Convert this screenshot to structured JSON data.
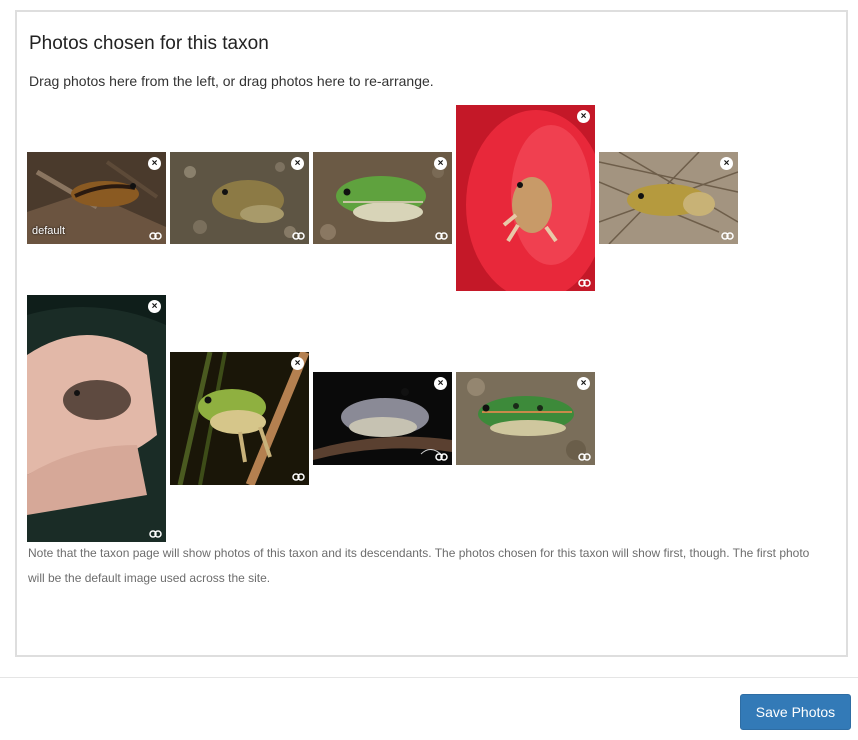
{
  "panel": {
    "title": "Photos chosen for this taxon",
    "instructions": "Drag photos here from the left, or drag photos here to re-arrange.",
    "note": "Note that the taxon page will show photos of this taxon and its descendants. The photos chosen for this taxon will show first, though. The first photo will be the default image used across the site."
  },
  "photos": {
    "default_label": "default",
    "remove_glyph": "×",
    "remove_icon": "close-circle-icon",
    "link_icon": "link-icon"
  },
  "footer": {
    "save_label": "Save Photos"
  },
  "colors": {
    "button_primary": "#337ab7",
    "panel_border": "#dedede",
    "note_text": "#6d6d6d"
  }
}
